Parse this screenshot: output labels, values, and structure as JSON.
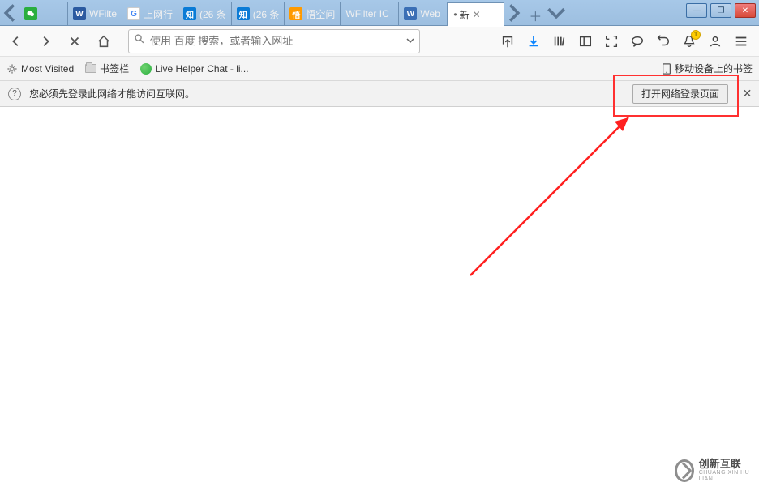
{
  "window": {
    "min": "—",
    "max": "❐",
    "close": "✕"
  },
  "tabs": {
    "prev_enabled": false,
    "next_enabled": true,
    "items": [
      {
        "label": "",
        "favicon_bg": "#2aae3f",
        "favicon_txt": ""
      },
      {
        "label": "WFilte",
        "favicon_bg": "#2b5aa0",
        "favicon_txt": "W"
      },
      {
        "label": "上网行",
        "favicon_bg": "#ffffff",
        "favicon_txt": "G"
      },
      {
        "label": "(26 条",
        "favicon_bg": "#0a7bd6",
        "favicon_txt": "知"
      },
      {
        "label": "(26 条",
        "favicon_bg": "#0a7bd6",
        "favicon_txt": "知"
      },
      {
        "label": "悟空问",
        "favicon_bg": "#ff9a00",
        "favicon_txt": "悟"
      },
      {
        "label": "WFilter IC",
        "favicon_bg": "",
        "favicon_txt": ""
      },
      {
        "label": "Web ",
        "favicon_bg": "#3b6fb5",
        "favicon_txt": "W"
      }
    ],
    "active": {
      "label": "新",
      "dirty_prefix": "•"
    }
  },
  "nav": {
    "search_placeholder": "使用 百度 搜索，或者输入网址"
  },
  "bookmarks": {
    "most_visited": "Most Visited",
    "toolbar_folder": "书签栏",
    "livehelper": "Live Helper Chat - li...",
    "mobile": "移动设备上的书签"
  },
  "notify": {
    "message": "您必须先登录此网络才能访问互联网。",
    "button": "打开网络登录页面"
  },
  "watermark": {
    "line1": "创新互联",
    "line2": "CHUANG XIN HU LIAN"
  }
}
